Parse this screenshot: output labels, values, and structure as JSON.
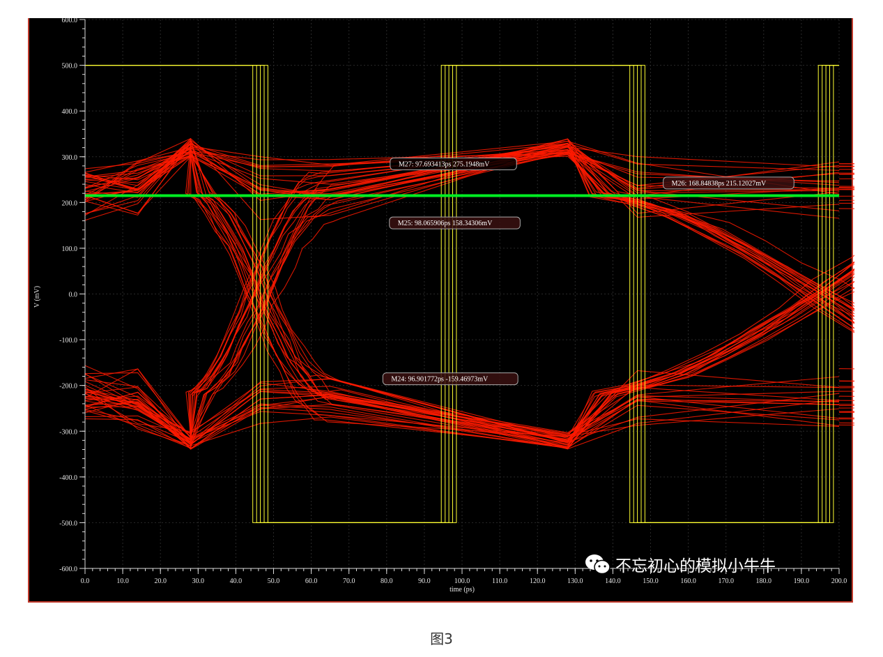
{
  "caption": "图3",
  "watermark": {
    "text": "不忘初心的模拟小牛牛",
    "icon": "wechat-icon"
  },
  "colors": {
    "background": "#000000",
    "frame": "#c0392b",
    "eye": "#ff1a00",
    "clock": "#ffff33",
    "threshold": "#00ee22",
    "axis": "#dddddd",
    "grid": "#2a2a2a"
  },
  "chart_data": {
    "type": "line",
    "title": "",
    "xlabel": "time (ps)",
    "ylabel": "V (mV)",
    "xlim": [
      0,
      200
    ],
    "ylim": [
      -600,
      600
    ],
    "x_ticks": [
      "0.0",
      "10.0",
      "20.0",
      "30.0",
      "40.0",
      "50.0",
      "60.0",
      "70.0",
      "80.0",
      "90.0",
      "100.0",
      "110.0",
      "120.0",
      "130.0",
      "140.0",
      "150.0",
      "160.0",
      "170.0",
      "180.0",
      "190.0",
      "200.0"
    ],
    "y_ticks": [
      "600.0",
      "500.0",
      "400.0",
      "300.0",
      "200.0",
      "100.0",
      "0.0",
      "-100.0",
      "-200.0",
      "-300.0",
      "-400.0",
      "-500.0",
      "-600.0"
    ],
    "grid": true,
    "series": [
      {
        "kind": "eye-diagram",
        "unit_interval_ps": 50,
        "crossing_times_ps": [
          46.5,
          146.5
        ],
        "wide_levels_mV": [
          -250,
          250
        ],
        "narrow_levels_mV": [
          -200,
          200
        ],
        "overshoot_mV": [
          -320,
          320
        ],
        "overshoot_time_ps": 28,
        "max_eye_opening_ps": 97
      },
      {
        "kind": "clock",
        "high_mV": 500,
        "low_mV": -500,
        "edges_ps": [
          0,
          46.5,
          96.5,
          146.5,
          196.5,
          200
        ],
        "jitter_ps": 2
      },
      {
        "kind": "threshold",
        "y_mV": 215
      }
    ],
    "markers": [
      {
        "label": "M27: 97.693413ps 275.1948mV",
        "x": 97.693413,
        "y": 275.1948
      },
      {
        "label": "M26: 168.84838ps 215.12027mV",
        "x": 168.84838,
        "y": 215.12027
      },
      {
        "label": "M25: 98.065906ps 158.34306mV",
        "x": 98.065906,
        "y": 158.34306
      },
      {
        "label": "M24: 96.901772ps -159.46973mV",
        "x": 96.901772,
        "y": -159.46973
      }
    ]
  }
}
